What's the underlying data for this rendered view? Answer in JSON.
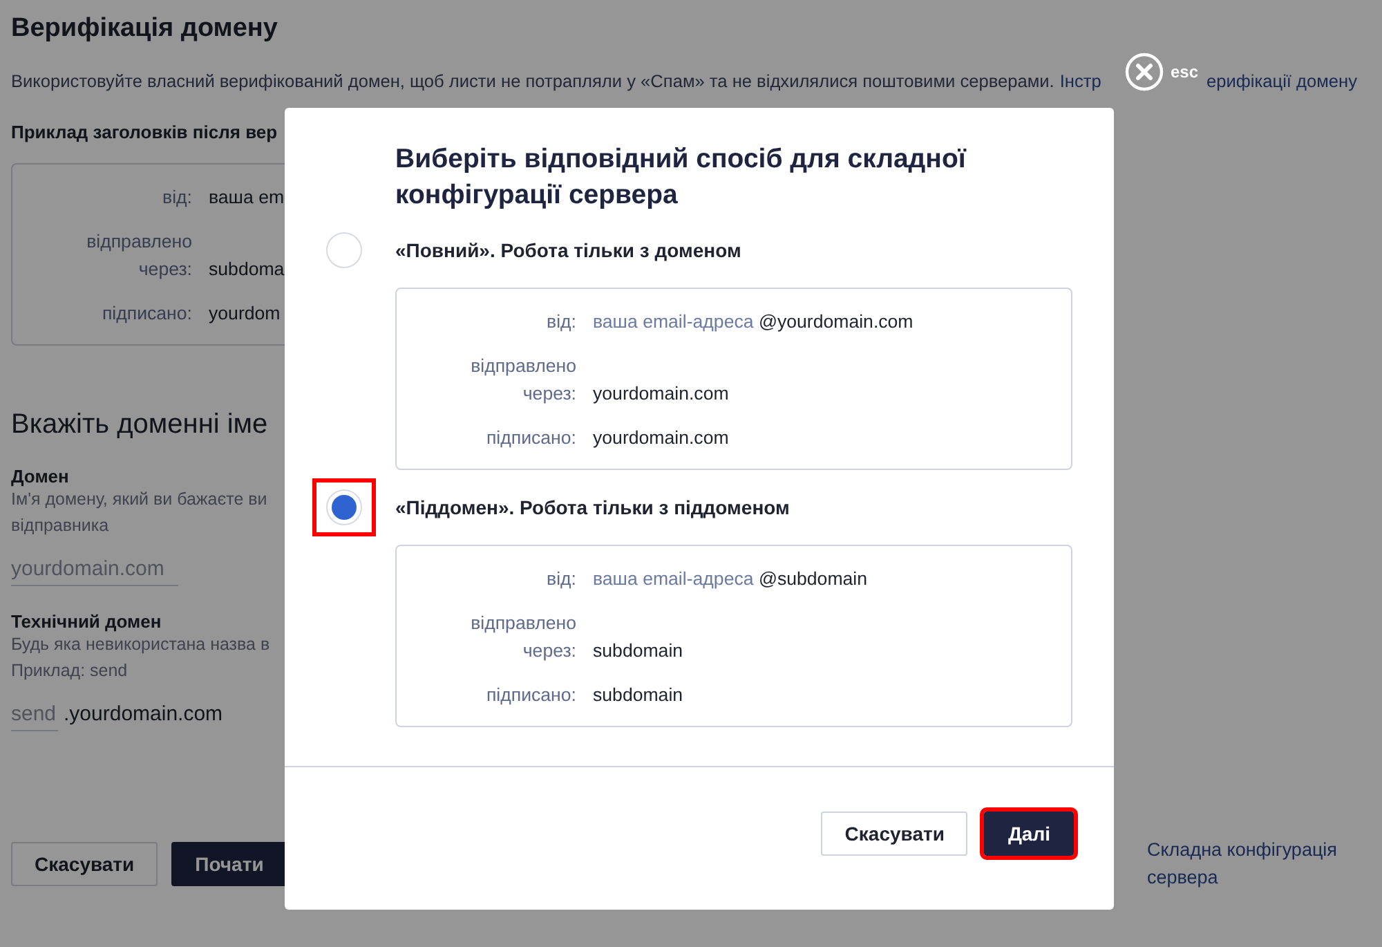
{
  "page": {
    "title": "Верифікація домену",
    "description": "Використовуйте власний верифікований домен, щоб листи не потрапляли у «Спам» та не відхилялися поштовими серверами.",
    "link_parts": [
      "Інстр",
      "ерифікації домену"
    ],
    "example_heading": "Приклад заголовків після вер",
    "example_rows": [
      {
        "label": "від:",
        "value": "ваша em"
      },
      {
        "label": "відправлено через:",
        "value": "subdoma"
      },
      {
        "label": "підписано:",
        "value": "yourdom"
      }
    ],
    "section_heading": "Вкажіть доменні іме",
    "fields": [
      {
        "label": "Домен",
        "hint": "Ім'я домену, який ви бажаєте ви\nвідправника",
        "placeholder": "yourdomain.com"
      },
      {
        "label": "Технічний домен",
        "hint": "Будь яка невикористана назва в\nПриклад: send",
        "placeholder": "send",
        "suffix": ".yourdomain.com"
      }
    ],
    "buttons": [
      "Скасувати",
      "Почати"
    ],
    "side_link": "Складна конфігурація сервера"
  },
  "close": {
    "label": "esc"
  },
  "modal": {
    "title": "Виберіть відповідний спосіб для складної конфігурації сервера",
    "options": [
      {
        "title": "«Повний». Робота тільки з доменом",
        "selected": false,
        "highlighted": false,
        "rows": [
          {
            "label": "від:",
            "muted": "ваша email-адреса",
            "value": "@yourdomain.com"
          },
          {
            "label": "відправлено через:",
            "value": "yourdomain.com"
          },
          {
            "label": "підписано:",
            "value": "yourdomain.com"
          }
        ]
      },
      {
        "title": "«Піддомен». Робота тільки з піддоменом",
        "selected": true,
        "highlighted": true,
        "rows": [
          {
            "label": "від:",
            "muted": "ваша email-адреса",
            "value": "@subdomain"
          },
          {
            "label": "відправлено через:",
            "value": "subdomain"
          },
          {
            "label": "підписано:",
            "value": "subdomain"
          }
        ]
      }
    ],
    "cancel": {
      "label": "Скасувати"
    },
    "next": {
      "label": "Далі",
      "highlighted": true
    }
  }
}
